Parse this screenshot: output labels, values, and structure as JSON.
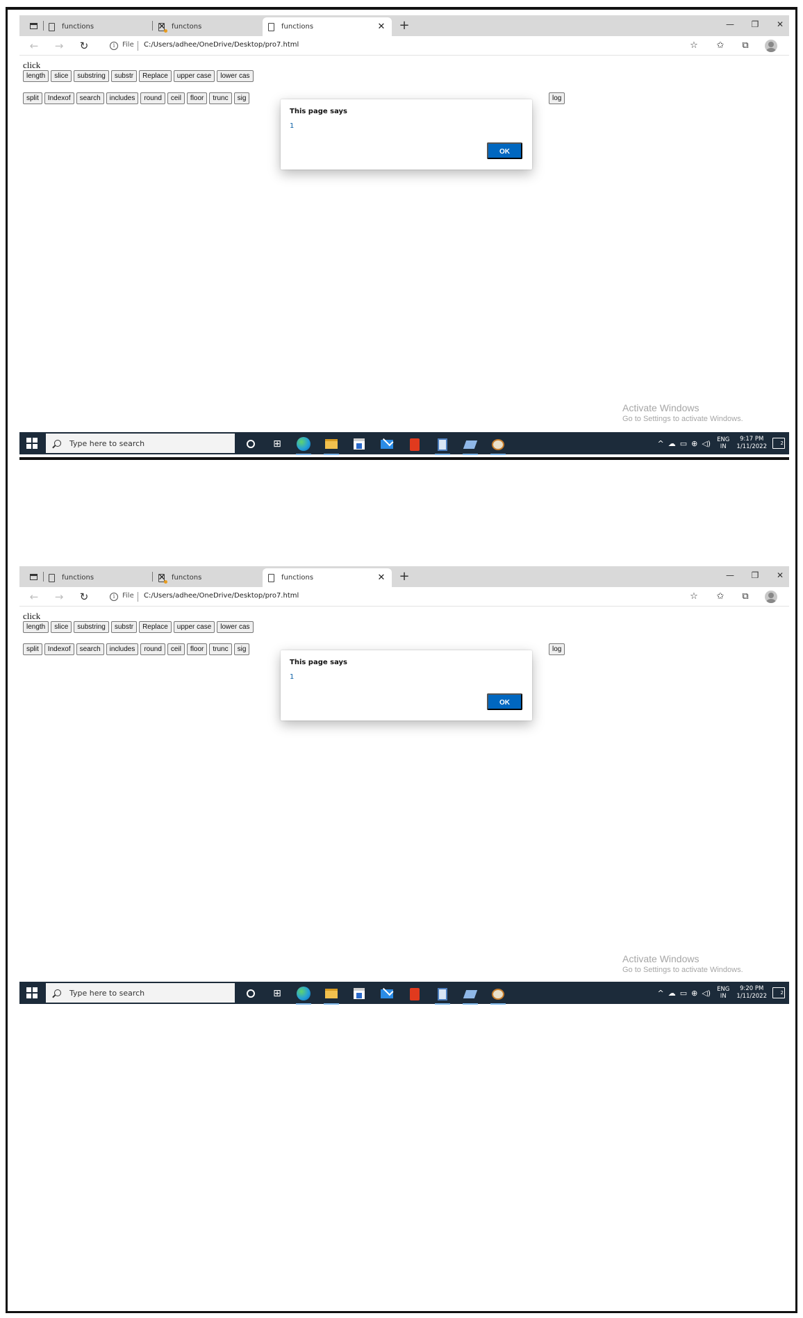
{
  "screenshots": [
    {
      "tabs": [
        {
          "title": "functions",
          "warning": false,
          "active": false
        },
        {
          "title": "functons",
          "warning": true,
          "active": false
        },
        {
          "title": "functions",
          "warning": false,
          "active": true
        }
      ],
      "url": {
        "scheme_label": "File",
        "path": "C:/Users/adhee/OneDrive/Desktop/pro7.html"
      },
      "page": {
        "label": "click",
        "row1": [
          "length",
          "slice",
          "substring",
          "substr",
          "Replace",
          "upper case",
          "lower cas"
        ],
        "row2": [
          "split",
          "Indexof",
          "search",
          "includes",
          "round",
          "ceil",
          "floor",
          "trunc",
          "sig"
        ],
        "row2_right": "log"
      },
      "dialog": {
        "title": "This page says",
        "message": "1",
        "ok_label": "OK"
      },
      "watermark": {
        "title": "Activate Windows",
        "subtitle": "Go to Settings to activate Windows."
      },
      "taskbar": {
        "search_placeholder": "Type here to search",
        "lang_top": "ENG",
        "lang_bottom": "IN",
        "time": "9:17 PM",
        "date": "1/11/2022",
        "notification_count": "2"
      }
    },
    {
      "tabs": [
        {
          "title": "functions",
          "warning": false,
          "active": false
        },
        {
          "title": "functons",
          "warning": true,
          "active": false
        },
        {
          "title": "functions",
          "warning": false,
          "active": true
        }
      ],
      "url": {
        "scheme_label": "File",
        "path": "C:/Users/adhee/OneDrive/Desktop/pro7.html"
      },
      "page": {
        "label": "click",
        "row1": [
          "length",
          "slice",
          "substring",
          "substr",
          "Replace",
          "upper case",
          "lower cas"
        ],
        "row2": [
          "split",
          "Indexof",
          "search",
          "includes",
          "round",
          "ceil",
          "floor",
          "trunc",
          "sig"
        ],
        "row2_right": "log"
      },
      "dialog": {
        "title": "This page says",
        "message": "1",
        "ok_label": "OK"
      },
      "watermark": {
        "title": "Activate Windows",
        "subtitle": "Go to Settings to activate Windows."
      },
      "taskbar": {
        "search_placeholder": "Type here to search",
        "lang_top": "ENG",
        "lang_bottom": "IN",
        "time": "9:20 PM",
        "date": "1/11/2022",
        "notification_count": "2"
      }
    }
  ],
  "icons": {
    "back": "arrow-left-icon",
    "forward": "arrow-right-icon",
    "refresh": "refresh-icon",
    "favorite_add": "star-plus-icon",
    "favorites": "favorites-list-icon",
    "collections": "collections-icon",
    "more": "ellipsis-icon"
  },
  "colors": {
    "dialog_ok": "#0067c0",
    "taskbar": "#1c2b3a",
    "tabstrip": "#d9d9d9"
  }
}
